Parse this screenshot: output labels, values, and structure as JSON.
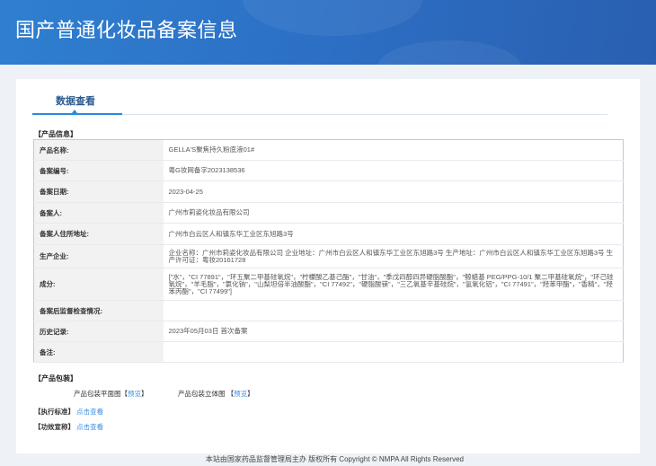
{
  "header": {
    "title": "国产普通化妆品备案信息"
  },
  "tabs": [
    {
      "label": "数据查看"
    }
  ],
  "product_info": {
    "section_label": "【产品信息】",
    "rows": [
      {
        "label": "产品名称:",
        "value": "GELLA'S聚焦持久粉底液01#"
      },
      {
        "label": "备案编号:",
        "value": "粤G妆网备字2023138536"
      },
      {
        "label": "备案日期:",
        "value": "2023-04-25"
      },
      {
        "label": "备案人:",
        "value": "广州市莉姿化妆品有限公司"
      },
      {
        "label": "备案人住所地址:",
        "value": "广州市白云区人和镇东华工业区东旭路3号"
      },
      {
        "label": "生产企业:",
        "value": "企业名称：广州市莉姿化妆品有限公司 企业地址：广州市白云区人和镇东华工业区东旭路3号 生产地址：广州市白云区人和镇东华工业区东旭路3号 生产许可证：粤妆20161728"
      },
      {
        "label": "成分:",
        "value": "[\"水\"，\"CI 77891\"，\"环五聚二甲基硅氧烷\"，\"柠檬酸乙基己酯\"，\"甘油\"，\"季戊四醇四异硬脂酸酯\"，\"鲸蜡基 PEG/PPG-10/1 聚二甲基硅氧烷\"，\"环己硅氧烷\"，\"羊毛脂\"，\"氯化钠\"，\"山梨坦倍半油酸酯\"，\"CI 77492\"，\"硬脂酸镁\"，\"三乙氧基辛基硅烷\"，\"氢氧化铝\"，\"CI 77491\"，\"羟苯甲酯\"，\"香精\"，\"羟苯丙酯\"，\"CI 77499\"]"
      },
      {
        "label": "备案后监督检查情况:",
        "value": ""
      },
      {
        "label": "历史记录:",
        "value": "2023年05月03日 首次备案"
      },
      {
        "label": "备注:",
        "value": ""
      }
    ]
  },
  "packaging": {
    "section_label": "【产品包装】",
    "flat_label": "产品包装平面图",
    "flat_link": "预览",
    "solid_label": "产品包装立体图",
    "solid_link": "预览",
    "bracket_open": "【",
    "bracket_close": "】"
  },
  "standard": {
    "label": "【执行标准】",
    "link": "点击查看"
  },
  "efficacy": {
    "label": "【功效宣称】",
    "link": "点击查看"
  },
  "footer": {
    "text": "本站由国家药品监督管理局主办 版权所有 Copyright © NMPA All Rights Reserved"
  }
}
